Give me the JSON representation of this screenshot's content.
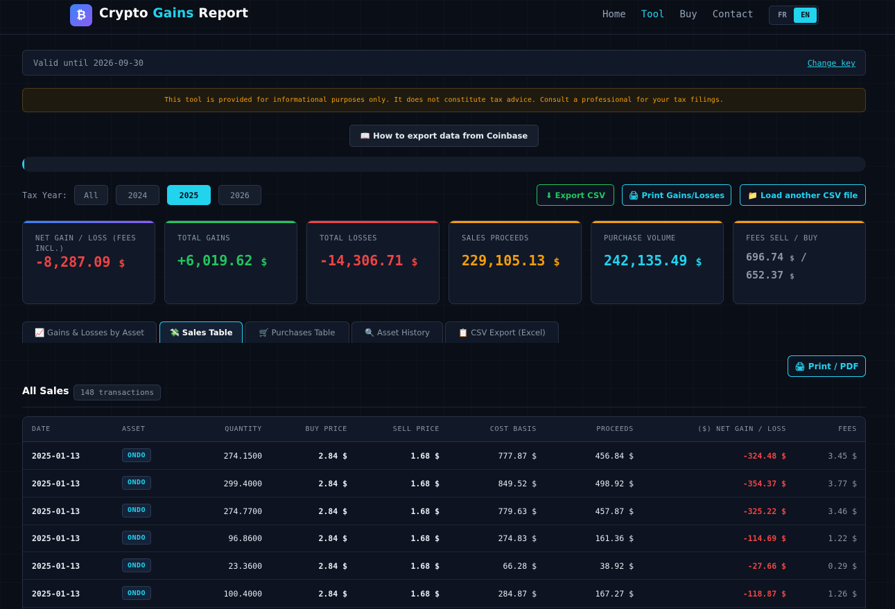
{
  "header": {
    "logo_glyph": "₿",
    "title_part1": "Crypto ",
    "title_accent": "Gains",
    "title_part2": " Report",
    "nav": [
      "Home",
      "Tool",
      "Buy",
      "Contact"
    ],
    "nav_active": "Tool",
    "lang": [
      "FR",
      "EN"
    ],
    "lang_active": "EN"
  },
  "license": {
    "valid_text": "Valid until 2026-09-30",
    "change_label": "Change key"
  },
  "disclaimer": "This tool is provided for informational purposes only. It does not constitute tax advice. Consult a professional for your tax filings.",
  "howto_label": "📖 How to export data from Coinbase",
  "tax_year": {
    "label": "Tax Year:",
    "options": [
      "All",
      "2024",
      "2025",
      "2026"
    ],
    "selected": "2025"
  },
  "actions": {
    "export_csv": "⬇ Export CSV",
    "print_gains": "🖨 Print Gains/Losses",
    "load_csv": "📁 Load another CSV file"
  },
  "cards": [
    {
      "label": "NET GAIN / LOSS (FEES INCL.)",
      "value": "-8,287.09",
      "currency": "$",
      "color": "#ef4444",
      "bar": "#8b5cf6"
    },
    {
      "label": "TOTAL GAINS",
      "value": "+6,019.62",
      "currency": "$",
      "color": "#22c55e",
      "bar": "#22c55e"
    },
    {
      "label": "TOTAL LOSSES",
      "value": "-14,306.71",
      "currency": "$",
      "color": "#ef4444",
      "bar": "#ef4444"
    },
    {
      "label": "SALES PROCEEDS",
      "value": "229,105.13",
      "currency": "$",
      "color": "#f59e0b",
      "bar": "#f59e0b"
    },
    {
      "label": "PURCHASE VOLUME",
      "value": "242,135.49",
      "currency": "$",
      "color": "#22d3ee",
      "bar": "#f59e0b"
    },
    {
      "label": "FEES SELL / BUY",
      "value_sell": "696.74",
      "value_buy": "652.37",
      "currency": "$",
      "separator": "/",
      "color": "#8b97a9",
      "bar": "#f59e0b"
    }
  ],
  "tabs": [
    {
      "label": "📈 Gains & Losses by Asset"
    },
    {
      "label": "💸 Sales Table"
    },
    {
      "label": "🛒 Purchases Table"
    },
    {
      "label": "🔍 Asset History"
    },
    {
      "label": "📋 CSV Export (Excel)"
    }
  ],
  "active_tab": "💸 Sales Table",
  "print_pdf": "🖨 Print / PDF",
  "sales": {
    "title": "All Sales",
    "count": "148 transactions",
    "columns": [
      "DATE",
      "ASSET",
      "QUANTITY",
      "BUY PRICE",
      "SELL PRICE",
      "COST BASIS",
      "PROCEEDS",
      "($) NET GAIN / LOSS",
      "FEES"
    ],
    "rows": [
      {
        "date": "2025-01-13",
        "asset": "ONDO",
        "qty": "274.1500",
        "buy": "2.84 $",
        "sell": "1.68 $",
        "cost": "777.87 $",
        "proceeds": "456.84 $",
        "net": "-324.48 $",
        "fees": "3.45 $"
      },
      {
        "date": "2025-01-13",
        "asset": "ONDO",
        "qty": "299.4000",
        "buy": "2.84 $",
        "sell": "1.68 $",
        "cost": "849.52 $",
        "proceeds": "498.92 $",
        "net": "-354.37 $",
        "fees": "3.77 $"
      },
      {
        "date": "2025-01-13",
        "asset": "ONDO",
        "qty": "274.7700",
        "buy": "2.84 $",
        "sell": "1.68 $",
        "cost": "779.63 $",
        "proceeds": "457.87 $",
        "net": "-325.22 $",
        "fees": "3.46 $"
      },
      {
        "date": "2025-01-13",
        "asset": "ONDO",
        "qty": "96.8600",
        "buy": "2.84 $",
        "sell": "1.68 $",
        "cost": "274.83 $",
        "proceeds": "161.36 $",
        "net": "-114.69 $",
        "fees": "1.22 $"
      },
      {
        "date": "2025-01-13",
        "asset": "ONDO",
        "qty": "23.3600",
        "buy": "2.84 $",
        "sell": "1.68 $",
        "cost": "66.28 $",
        "proceeds": "38.92 $",
        "net": "-27.66 $",
        "fees": "0.29 $"
      },
      {
        "date": "2025-01-13",
        "asset": "ONDO",
        "qty": "100.4000",
        "buy": "2.84 $",
        "sell": "1.68 $",
        "cost": "284.87 $",
        "proceeds": "167.27 $",
        "net": "-118.87 $",
        "fees": "1.26 $"
      }
    ]
  }
}
